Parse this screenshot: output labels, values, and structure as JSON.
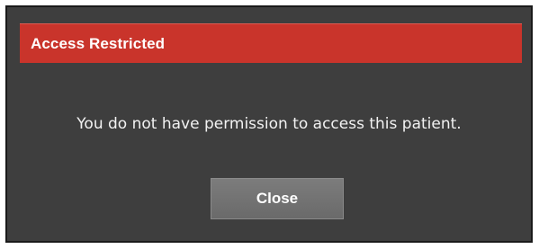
{
  "dialog": {
    "title": "Access Restricted",
    "message": "You do not have permission to access this patient.",
    "close_label": "Close"
  },
  "colors": {
    "titlebar": "#c9342b",
    "background": "#3e3e3e",
    "button": "#737373",
    "text": "#ffffff"
  }
}
